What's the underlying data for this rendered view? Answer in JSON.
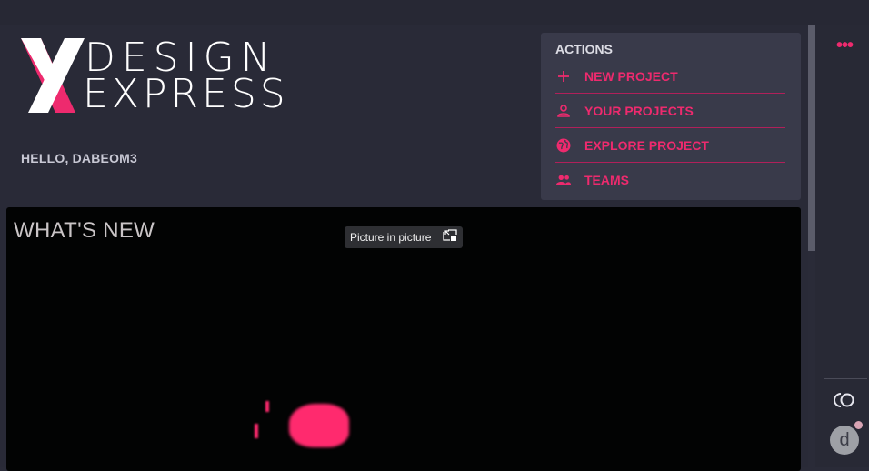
{
  "brand": {
    "line1": "DESIGN",
    "line2": "EXPRESS",
    "accent": "#ee2a6e"
  },
  "greeting": "HELLO, DABEOM3",
  "actions": {
    "title": "ACTIONS",
    "items": [
      {
        "label": "NEW PROJECT",
        "icon": "plus-icon"
      },
      {
        "label": "YOUR PROJECTS",
        "icon": "person-icon"
      },
      {
        "label": "EXPLORE PROJECT",
        "icon": "globe-icon"
      },
      {
        "label": "TEAMS",
        "icon": "people-icon"
      }
    ]
  },
  "news": {
    "title": "WHAT'S NEW",
    "pip_label": "Picture in picture"
  },
  "rightbar": {
    "more": "•••",
    "avatar_letter": "d"
  }
}
